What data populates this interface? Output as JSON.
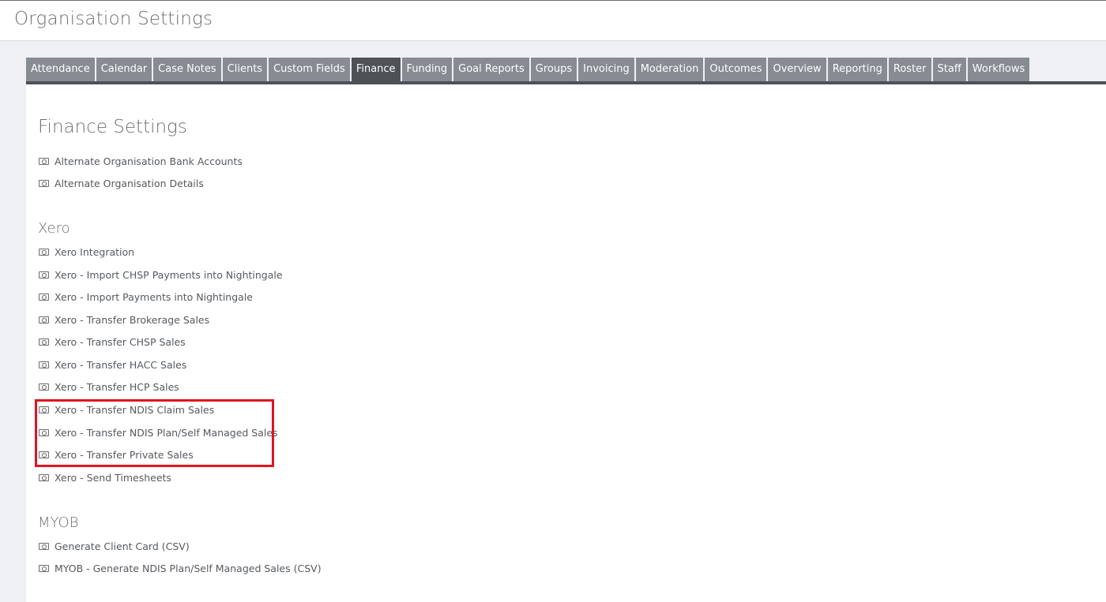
{
  "page_title": "Organisation Settings",
  "tabs": [
    {
      "label": "Attendance",
      "active": false
    },
    {
      "label": "Calendar",
      "active": false
    },
    {
      "label": "Case Notes",
      "active": false
    },
    {
      "label": "Clients",
      "active": false
    },
    {
      "label": "Custom Fields",
      "active": false
    },
    {
      "label": "Finance",
      "active": true
    },
    {
      "label": "Funding",
      "active": false
    },
    {
      "label": "Goal Reports",
      "active": false
    },
    {
      "label": "Groups",
      "active": false
    },
    {
      "label": "Invoicing",
      "active": false
    },
    {
      "label": "Moderation",
      "active": false
    },
    {
      "label": "Outcomes",
      "active": false
    },
    {
      "label": "Overview",
      "active": false
    },
    {
      "label": "Reporting",
      "active": false
    },
    {
      "label": "Roster",
      "active": false
    },
    {
      "label": "Staff",
      "active": false
    },
    {
      "label": "Workflows",
      "active": false
    }
  ],
  "finance": {
    "title": "Finance Settings",
    "links": [
      "Alternate Organisation Bank Accounts",
      "Alternate Organisation Details"
    ]
  },
  "xero": {
    "title": "Xero",
    "links": [
      "Xero Integration",
      "Xero - Import CHSP Payments into Nightingale",
      "Xero - Import Payments into Nightingale",
      "Xero - Transfer Brokerage Sales",
      "Xero - Transfer CHSP Sales",
      "Xero - Transfer HACC Sales",
      "Xero - Transfer HCP Sales",
      "Xero - Transfer NDIS Claim Sales",
      "Xero - Transfer NDIS Plan/Self Managed Sales",
      "Xero - Transfer Private Sales",
      "Xero - Send Timesheets"
    ]
  },
  "myob": {
    "title": "MYOB",
    "links": [
      "Generate Client Card (CSV)",
      "MYOB - Generate NDIS Plan/Self Managed Sales (CSV)"
    ]
  },
  "colors": {
    "tab_bg": "#868c92",
    "tab_active_bg": "#4d5257",
    "highlight": "#e0141e"
  },
  "icons": {
    "link_icon": "money-icon"
  }
}
